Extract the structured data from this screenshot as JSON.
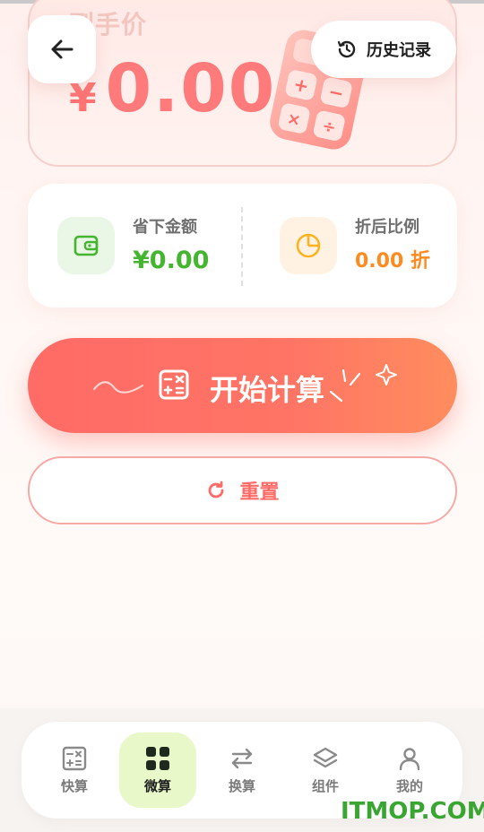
{
  "header": {
    "back_icon": "arrow-left-icon",
    "history_icon": "history-clock-icon",
    "history_label": "历史记录"
  },
  "price_card": {
    "label": "到手价",
    "currency": "¥",
    "amount": "0.00",
    "illustration": "calculator-illustration"
  },
  "stats": {
    "saved": {
      "icon": "wallet-icon",
      "title": "省下金额",
      "value": "¥0.00",
      "color": "#43b52e"
    },
    "ratio": {
      "icon": "pie-chart-icon",
      "title": "折后比例",
      "value": "0.00 折",
      "color": "#ff8a1f"
    }
  },
  "actions": {
    "calculate_label": "开始计算",
    "calculate_icon": "calculator-icon",
    "reset_label": "重置",
    "reset_icon": "refresh-icon"
  },
  "nav": {
    "items": [
      {
        "label": "快算",
        "icon": "calculator-icon",
        "active": false
      },
      {
        "label": "微算",
        "icon": "grid-icon",
        "active": true
      },
      {
        "label": "换算",
        "icon": "swap-icon",
        "active": false
      },
      {
        "label": "组件",
        "icon": "layers-icon",
        "active": false
      },
      {
        "label": "我的",
        "icon": "user-icon",
        "active": false
      }
    ]
  },
  "watermark": "ITMOP.COM",
  "colors": {
    "accent": "#ff6b66",
    "accent_end": "#ff8d5e",
    "green": "#43b52e",
    "orange": "#ff8a1f",
    "active_nav_bg": "#e9f8c8"
  }
}
